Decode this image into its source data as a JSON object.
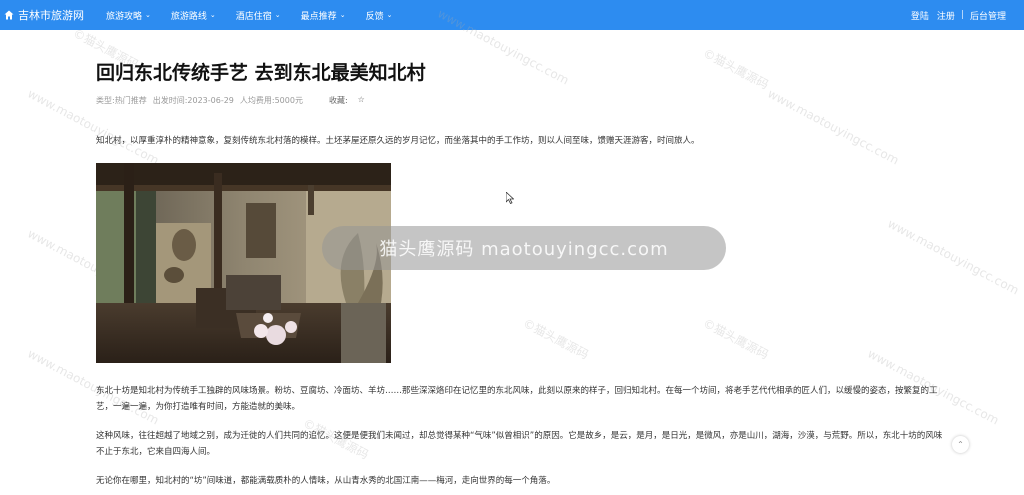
{
  "nav": {
    "brand": "吉林市旅游网",
    "items": [
      {
        "label": "旅游攻略"
      },
      {
        "label": "旅游路线"
      },
      {
        "label": "酒店住宿"
      },
      {
        "label": "最点推荐"
      },
      {
        "label": "反馈"
      }
    ],
    "login": "登陆",
    "register": "注册",
    "admin": "后台管理",
    "separator": "|"
  },
  "article": {
    "title": "回归东北传统手艺 去到东北最美知北村",
    "meta": {
      "type": "类型:热门推荐",
      "date": "出发时间:2023-06-29",
      "cost": "人均费用:5000元",
      "favorite": "收藏:",
      "star": "☆"
    },
    "paragraphs": [
      "知北村，以厚重淳朴的精神意象，复刻传统东北村落的模样。土坯茅屋还原久远的岁月记忆，而坐落其中的手工作坊，则以人间至味，馈赠天涯游客，时间旅人。",
      "东北十坊是知北村为传统手工独辟的风味场景。粉坊、豆腐坊、冷面坊、羊坊……那些深深烙印在记忆里的东北风味，此刻以原来的样子，回归知北村。在每一个坊间，将老手艺代代相承的匠人们，以缓慢的姿态，按繁复的工艺，一遍一遍，为你打造唯有时间，方能造就的美味。",
      "这种风味，往往超越了地域之别，成为迁徙的人们共同的追忆。这便是便我们未闻过，却总觉得某种“气味”似曾相识”的原因。它是故乡，是云，是月，是日光，是微风，亦是山川，湖海，沙漠，与荒野。所以，东北十坊的风味不止于东北，它来自四海人间。",
      "无论你在哪里，知北村的“坊”间味道，都能满载质朴的人情味，从山青水秀的北国江南——梅河，走向世界的每一个角落。"
    ]
  },
  "watermark": {
    "bar_text": "猫头鹰源码 maotouyingcc.com",
    "diag_a": "©猫头鹰源码",
    "diag_b": "www.maotouyingcc.com"
  },
  "back_top_icon": "chevron-up-icon"
}
